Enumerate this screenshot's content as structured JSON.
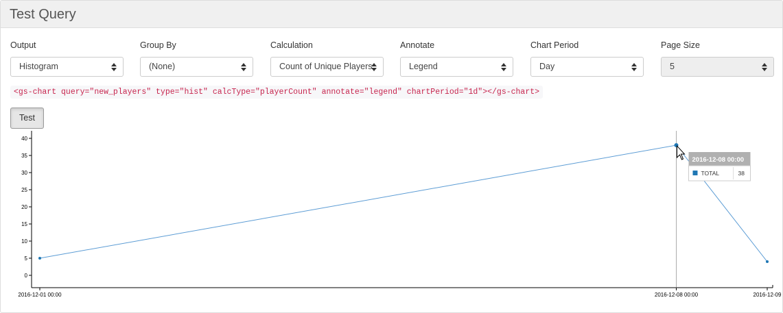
{
  "panel": {
    "title": "Test Query"
  },
  "controls": [
    {
      "label": "Output",
      "value": "Histogram",
      "disabled": false,
      "key": "output"
    },
    {
      "label": "Group By",
      "value": "(None)",
      "disabled": false,
      "key": "group-by"
    },
    {
      "label": "Calculation",
      "value": "Count of Unique Players",
      "disabled": false,
      "key": "calculation"
    },
    {
      "label": "Annotate",
      "value": "Legend",
      "disabled": false,
      "key": "annotate"
    },
    {
      "label": "Chart Period",
      "value": "Day",
      "disabled": false,
      "key": "chart-period"
    },
    {
      "label": "Page Size",
      "value": "5",
      "disabled": true,
      "key": "page-size"
    }
  ],
  "code_snippet": "<gs-chart query=\"new_players\" type=\"hist\" calcType=\"playerCount\" annotate=\"legend\" chartPeriod=\"1d\"></gs-chart>",
  "test_button": {
    "label": "Test"
  },
  "colors": {
    "series": "#1f77b4",
    "line": "#5a9bd4",
    "code": "#c7254e"
  },
  "chart_data": {
    "type": "line",
    "x_tick_labels": [
      "2016-12-01 00:00",
      "2016-12-08 00:00",
      "2016-12-09"
    ],
    "y_ticks": [
      0,
      5,
      10,
      15,
      20,
      25,
      30,
      35,
      40
    ],
    "ylim": [
      -2,
      42
    ],
    "xlim": [
      "2016-12-01 00:00",
      "2016-12-09 01:00"
    ],
    "points": [
      {
        "x": "2016-12-01 00:00",
        "y": 5
      },
      {
        "x": "2016-12-08 00:00",
        "y": 38
      },
      {
        "x": "2016-12-09 00:00",
        "y": 4
      }
    ],
    "series": [
      {
        "name": "TOTAL"
      }
    ],
    "tooltip": {
      "title": "2016-12-08 00:00",
      "series": "TOTAL",
      "value": "38"
    }
  }
}
